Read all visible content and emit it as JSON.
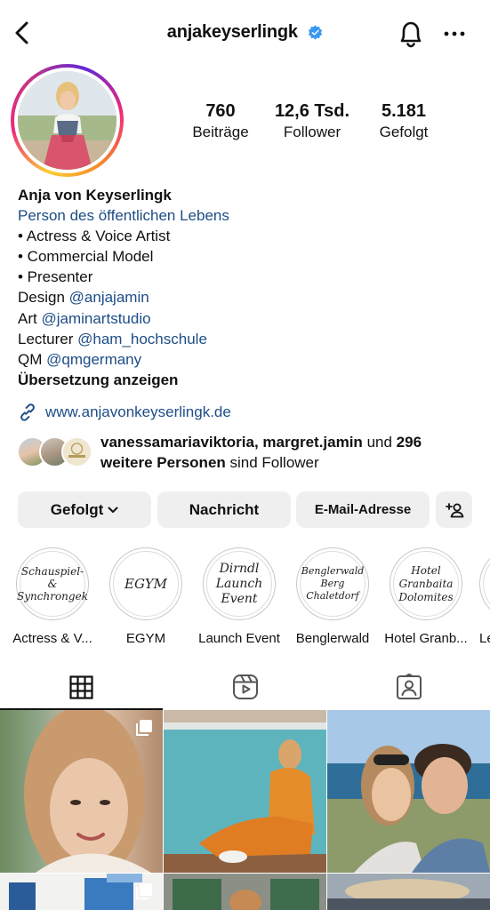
{
  "header": {
    "username": "anjakeyserlingk",
    "verified": true,
    "icons": [
      "back-arrow-icon",
      "bell-icon",
      "more-icon"
    ]
  },
  "profile": {
    "stats": [
      {
        "value": "760",
        "label": "Beiträge"
      },
      {
        "value": "12,6 Tsd.",
        "label": "Follower"
      },
      {
        "value": "5.181",
        "label": "Gefolgt"
      }
    ],
    "name": "Anja von Keyserlingk",
    "category": "Person des öffentlichen Lebens",
    "bio_lines": [
      "• Actress & Voice Artist",
      "• Commercial Model",
      "• Presenter"
    ],
    "credits": [
      {
        "label": "Design",
        "mention": "@anjajamin"
      },
      {
        "label": "Art",
        "mention": "@jaminartstudio"
      },
      {
        "label": "Lecturer",
        "mention": "@ham_hochschule"
      },
      {
        "label": "QM",
        "mention": "@qmgermany"
      }
    ],
    "translate": "Übersetzung anzeigen",
    "website": "www.anjavonkeyserlingk.de"
  },
  "followed_by": {
    "names": "vanessamariaviktoria, margret.jamin",
    "und": "und",
    "count": "296",
    "more": "weitere Personen",
    "suffix": "sind Follower"
  },
  "actions": {
    "following": "Gefolgt",
    "message": "Nachricht",
    "email": "E-Mail-Adresse"
  },
  "highlights": [
    {
      "label": "Actress & V...",
      "cover": "Schauspiel- & Synchrongek"
    },
    {
      "label": "EGYM",
      "cover": "EGYM"
    },
    {
      "label": "Launch Event",
      "cover": "Dirndl Launch Event"
    },
    {
      "label": "Benglerwald",
      "cover": "Benglerwald Berg Chaletdorf"
    },
    {
      "label": "Hotel Granb...",
      "cover": "Hotel Granbaita Dolomites"
    },
    {
      "label": "Le",
      "cover": ""
    }
  ],
  "tabs": [
    "grid-icon",
    "reels-icon",
    "tagged-icon"
  ],
  "colors": {
    "link": "#1d4d86",
    "verified": "#3897f0",
    "button": "#efefef"
  }
}
